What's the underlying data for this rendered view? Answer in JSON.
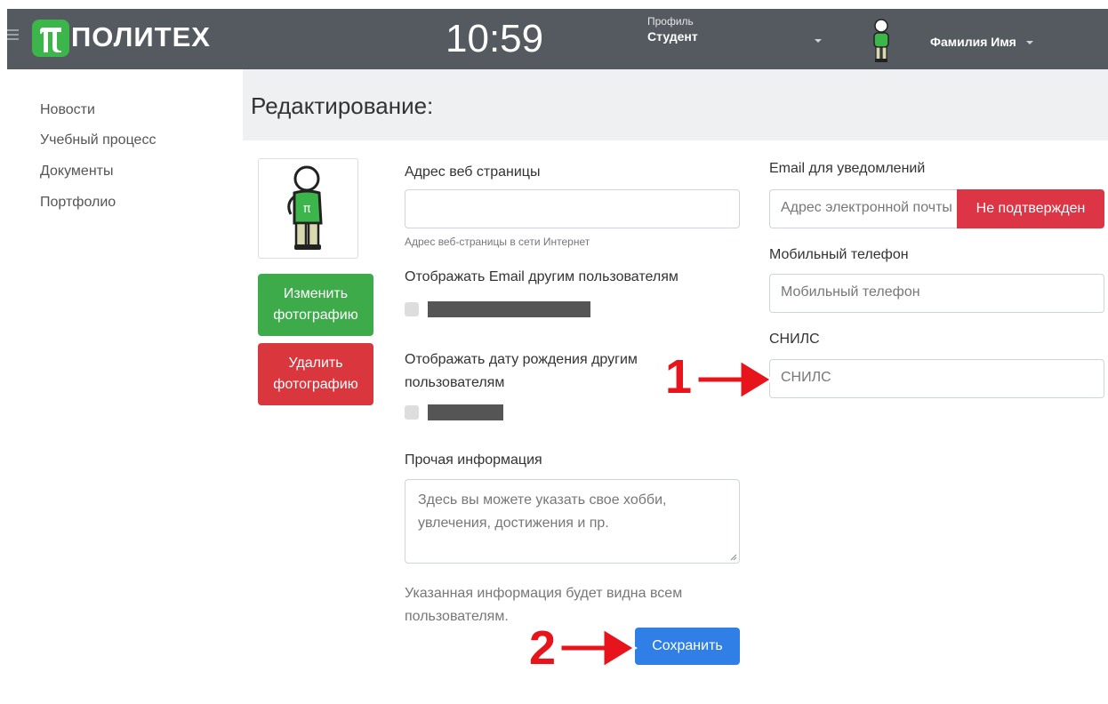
{
  "header": {
    "logo_text": "ПОЛИТЕХ",
    "clock": "10:59",
    "profile_caption": "Профиль",
    "profile_value": "Студент",
    "user_name": "Фамилия Имя"
  },
  "sidebar": {
    "items": [
      {
        "label": "Новости"
      },
      {
        "label": "Учебный процесс"
      },
      {
        "label": "Документы"
      },
      {
        "label": "Портфолио"
      }
    ]
  },
  "page": {
    "title": "Редактирование:"
  },
  "photo": {
    "change_label": "Изменить фотографию",
    "delete_label": "Удалить фотографию"
  },
  "form": {
    "website_label": "Адрес веб страницы",
    "website_value": "",
    "website_help": "Адрес веб-страницы в сети Интернет",
    "show_email_label": "Отображать Email другим пользователям",
    "show_birthdate_label": "Отображать дату рождения другим пользователям",
    "other_info_label": "Прочая информация",
    "other_info_placeholder": "Здесь вы можете указать свое хобби, увлечения, достижения и пр.",
    "visibility_note": "Указанная информация будет видна всем пользователям.",
    "save_label": "Сохранить",
    "notify_email_label": "Email для уведомлений",
    "notify_email_placeholder": "Адрес электронной почты",
    "unconfirmed_label": "Не подтвержден",
    "mobile_label": "Мобильный телефон",
    "mobile_placeholder": "Мобильный телефон",
    "snils_label": "СНИЛС",
    "snils_placeholder": "СНИЛС"
  },
  "annotations": {
    "marker_1": "1",
    "marker_2": "2"
  },
  "colors": {
    "header_bg": "#545a5f",
    "brand_green": "#3cb54a",
    "danger": "#dc3545",
    "primary": "#2f7fe6",
    "annotation_red": "#e8141b"
  }
}
